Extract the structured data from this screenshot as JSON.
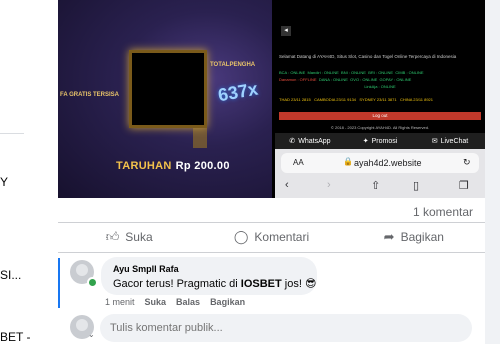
{
  "left_panel": {
    "fragments": [
      "Y",
      "SI...",
      "BET -"
    ]
  },
  "media": {
    "game": {
      "bet_label": "TARUHAN",
      "bet_amount": "Rp 200.00",
      "multiplier": "637x",
      "label_left": "FA GRATIS TERSISA",
      "label_right": "TOTALPENGHA"
    },
    "site": {
      "welcome": "Selamat Datang di AYAH4D, Situs Slot, Casino dan Togel Online Terpercaya di Indonesia",
      "bank_row_1": [
        "BCA : ONLINE",
        "Mandiri : ONLINE",
        "BNI : ONLINE",
        "BRI : ONLINE",
        "CIMB : ONLINE"
      ],
      "bank_row_2": [
        "Danamon : OFFLINE",
        "DANA : ONLINE",
        "OVO : ONLINE",
        "GOPAY : ONLINE"
      ],
      "bank_row_3": [
        "LinkAja : ONLINE"
      ],
      "togel_row": [
        "THAD 23/11 2815",
        "CAMBODIA 23/11 9134",
        "SYDNEY 23/11 3871",
        "CHINA 23/11 8921"
      ],
      "logout": "Log out",
      "copyright": "© 2018 - 2023 Copyright AYAH4D. All Rights Reserved.",
      "nav": [
        "WhatsApp",
        "Promosi",
        "LiveChat"
      ]
    },
    "browser": {
      "aa": "AA",
      "url": "ayah4d2.website"
    }
  },
  "post": {
    "comment_count": "1 komentar",
    "actions": {
      "like": "Suka",
      "comment": "Komentari",
      "share": "Bagikan"
    }
  },
  "comment": {
    "author": "Ayu Smpll Rafa",
    "text_before": "Gacor terus! Pragmatic di ",
    "text_bold": "IOSBET",
    "text_after": " jos! 😎",
    "time": "1 menit",
    "like": "Suka",
    "reply": "Balas",
    "share": "Bagikan"
  },
  "composer": {
    "placeholder": "Tulis komentar publik..."
  },
  "colors": {
    "accent": "#1877f2",
    "online": "#31a24c",
    "secondary_text": "#65676b"
  }
}
